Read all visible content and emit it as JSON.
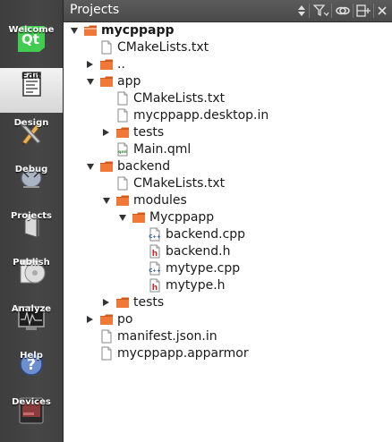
{
  "sidebar": {
    "modes": [
      {
        "label": "Welcome",
        "icon": "qt-logo-icon",
        "active": false
      },
      {
        "label": "Edit",
        "icon": "edit-icon",
        "active": true
      },
      {
        "label": "Design",
        "icon": "design-icon",
        "active": false
      },
      {
        "label": "Debug",
        "icon": "debug-icon",
        "active": false
      },
      {
        "label": "Projects",
        "icon": "projects-icon",
        "active": false
      },
      {
        "label": "Publish",
        "icon": "publish-icon",
        "active": false
      },
      {
        "label": "Analyze",
        "icon": "analyze-icon",
        "active": false
      },
      {
        "label": "Help",
        "icon": "help-icon",
        "active": false
      },
      {
        "label": "Devices",
        "icon": "devices-icon",
        "active": false
      }
    ],
    "qt_logo_text": "Qt",
    "help_glyph": "?"
  },
  "header": {
    "title": "Projects"
  },
  "tree": [
    {
      "label": "mycppapp",
      "type": "project",
      "depth": 0,
      "expand": "open",
      "bold": true
    },
    {
      "label": "CMakeLists.txt",
      "type": "file",
      "depth": 1,
      "expand": "none"
    },
    {
      "label": "..",
      "type": "folder",
      "depth": 1,
      "expand": "closed"
    },
    {
      "label": "app",
      "type": "folder",
      "depth": 1,
      "expand": "open"
    },
    {
      "label": "CMakeLists.txt",
      "type": "file",
      "depth": 2,
      "expand": "none"
    },
    {
      "label": "mycppapp.desktop.in",
      "type": "file",
      "depth": 2,
      "expand": "none"
    },
    {
      "label": "tests",
      "type": "folder",
      "depth": 2,
      "expand": "closed"
    },
    {
      "label": "Main.qml",
      "type": "qml",
      "depth": 2,
      "expand": "none"
    },
    {
      "label": "backend",
      "type": "folder",
      "depth": 1,
      "expand": "open"
    },
    {
      "label": "CMakeLists.txt",
      "type": "file",
      "depth": 2,
      "expand": "none"
    },
    {
      "label": "modules",
      "type": "folder",
      "depth": 2,
      "expand": "open"
    },
    {
      "label": "Mycppapp",
      "type": "folder",
      "depth": 3,
      "expand": "open"
    },
    {
      "label": "backend.cpp",
      "type": "cpp",
      "depth": 4,
      "expand": "none"
    },
    {
      "label": "backend.h",
      "type": "header",
      "depth": 4,
      "expand": "none"
    },
    {
      "label": "mytype.cpp",
      "type": "cpp",
      "depth": 4,
      "expand": "none"
    },
    {
      "label": "mytype.h",
      "type": "header",
      "depth": 4,
      "expand": "none"
    },
    {
      "label": "tests",
      "type": "folder",
      "depth": 2,
      "expand": "closed"
    },
    {
      "label": "po",
      "type": "folder",
      "depth": 1,
      "expand": "closed"
    },
    {
      "label": "manifest.json.in",
      "type": "file",
      "depth": 1,
      "expand": "none"
    },
    {
      "label": "mycppapp.apparmor",
      "type": "file",
      "depth": 1,
      "expand": "none"
    }
  ],
  "icon_glyphs": {
    "cpp": "C++",
    "header": "h",
    "qml": "qml"
  },
  "colors": {
    "folder": "#f07838",
    "folder_dark": "#d25a1c",
    "sidebar": "#424242",
    "header": "#525252"
  }
}
